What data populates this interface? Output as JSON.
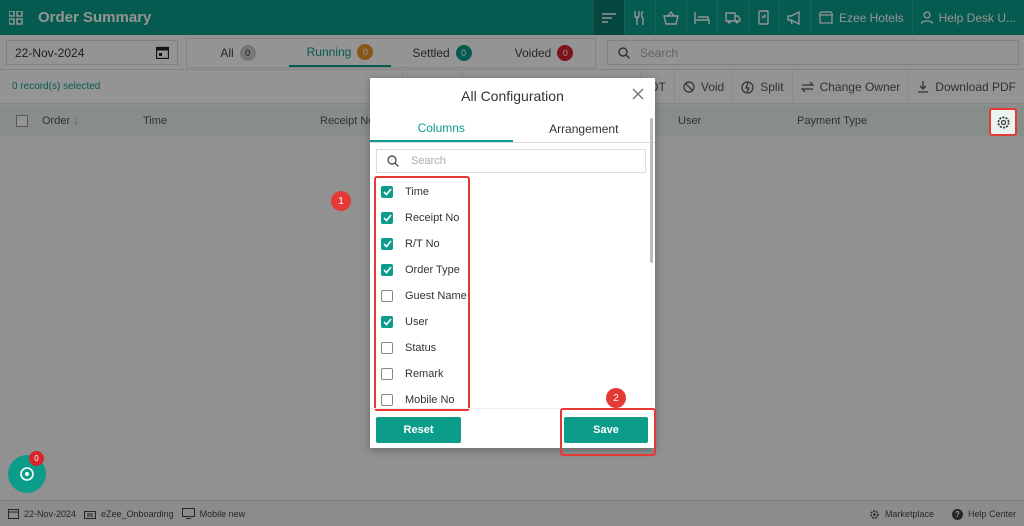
{
  "app": {
    "title": "Order Summary"
  },
  "topbar": {
    "icons": [
      "list-filter-icon",
      "fork-knife-icon",
      "basket-icon",
      "bed-icon",
      "truck-icon",
      "phone-transfer-icon",
      "megaphone-icon"
    ],
    "outlet": "Ezee Hotels",
    "user": "Help Desk U..."
  },
  "filters": {
    "date": "22-Nov-2024",
    "tabs": [
      {
        "label": "All",
        "count": "0"
      },
      {
        "label": "Running",
        "count": "0"
      },
      {
        "label": "Settled",
        "count": "0"
      },
      {
        "label": "Voided",
        "count": "0"
      }
    ],
    "search_placeholder": "Search"
  },
  "actionbar": {
    "selected": "0 record(s) selected",
    "actions": [
      "F",
      "OT",
      "Void",
      "Split",
      "Change Owner",
      "Download PDF"
    ]
  },
  "table": {
    "columns": [
      "Order",
      "Time",
      "Receipt No",
      "User",
      "Payment Type"
    ]
  },
  "modal": {
    "title": "All Configuration",
    "tabs": [
      "Columns",
      "Arrangement"
    ],
    "search_placeholder": "Search",
    "items": [
      {
        "label": "Time",
        "checked": true
      },
      {
        "label": "Receipt No",
        "checked": true
      },
      {
        "label": "R/T No",
        "checked": true
      },
      {
        "label": "Order Type",
        "checked": true
      },
      {
        "label": "Guest Name",
        "checked": false
      },
      {
        "label": "User",
        "checked": true
      },
      {
        "label": "Status",
        "checked": false
      },
      {
        "label": "Remark",
        "checked": false
      },
      {
        "label": "Mobile No",
        "checked": false
      }
    ],
    "reset_label": "Reset",
    "save_label": "Save"
  },
  "markers": [
    "1",
    "2"
  ],
  "fab": {
    "count": "0"
  },
  "footer": {
    "date": "22-Nov-2024",
    "property": "eZee_Onboarding",
    "device": "Mobile new",
    "marketplace": "Marketplace",
    "help": "Help Center"
  },
  "colors": {
    "accent": "#0b9d8a",
    "highlight": "#e53935"
  }
}
